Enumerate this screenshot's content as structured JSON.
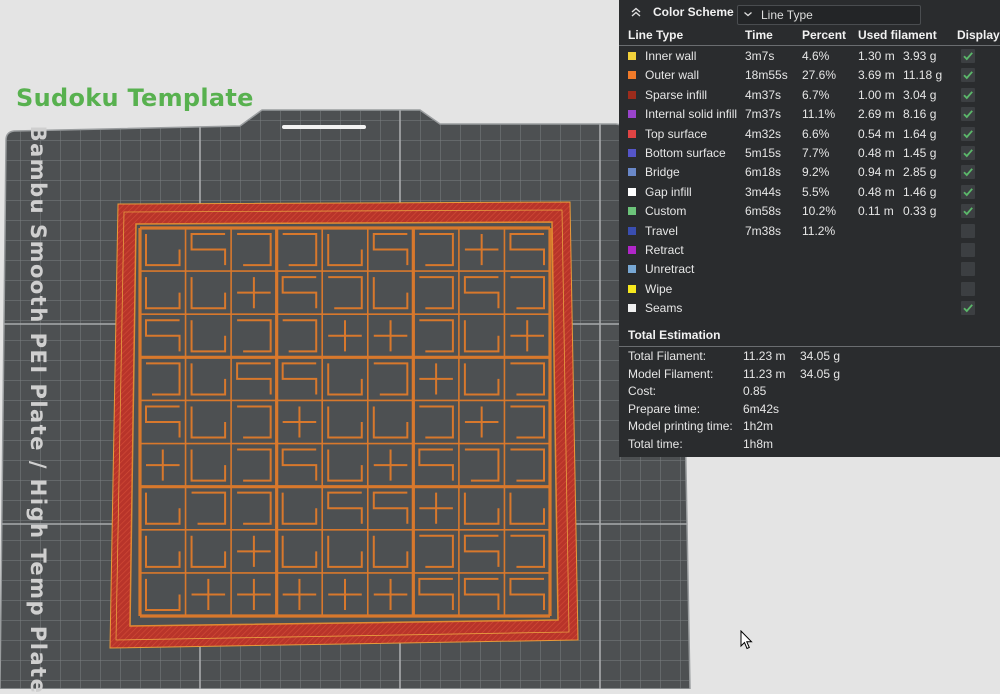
{
  "plate": {
    "title": "Sudoku Template",
    "label": "Bambu Smooth PEI Plate / High Temp Plate"
  },
  "panel": {
    "title": "Color Scheme",
    "scheme_value": "Line Type",
    "headers": {
      "line_type": "Line Type",
      "time": "Time",
      "percent": "Percent",
      "used_filament": "Used filament",
      "display": "Display"
    },
    "rows": [
      {
        "name": "Inner wall",
        "color": "#f2d13b",
        "time": "3m7s",
        "percent": "4.6%",
        "length": "1.30 m",
        "weight": "3.93 g",
        "display": true
      },
      {
        "name": "Outer wall",
        "color": "#f07a2a",
        "time": "18m55s",
        "percent": "27.6%",
        "length": "3.69 m",
        "weight": "11.18 g",
        "display": true
      },
      {
        "name": "Sparse infill",
        "color": "#9c2c1c",
        "time": "4m37s",
        "percent": "6.7%",
        "length": "1.00 m",
        "weight": "3.04 g",
        "display": true
      },
      {
        "name": "Internal solid infill",
        "color": "#9a44cc",
        "time": "7m37s",
        "percent": "11.1%",
        "length": "2.69 m",
        "weight": "8.16 g",
        "display": true
      },
      {
        "name": "Top surface",
        "color": "#e04444",
        "time": "4m32s",
        "percent": "6.6%",
        "length": "0.54 m",
        "weight": "1.64 g",
        "display": true
      },
      {
        "name": "Bottom surface",
        "color": "#5555c8",
        "time": "5m15s",
        "percent": "7.7%",
        "length": "0.48 m",
        "weight": "1.45 g",
        "display": true
      },
      {
        "name": "Bridge",
        "color": "#6a88c8",
        "time": "6m18s",
        "percent": "9.2%",
        "length": "0.94 m",
        "weight": "2.85 g",
        "display": true
      },
      {
        "name": "Gap infill",
        "color": "#ffffff",
        "time": "3m44s",
        "percent": "5.5%",
        "length": "0.48 m",
        "weight": "1.46 g",
        "display": true
      },
      {
        "name": "Custom",
        "color": "#6cc47a",
        "time": "6m58s",
        "percent": "10.2%",
        "length": "0.11 m",
        "weight": "0.33 g",
        "display": true
      },
      {
        "name": "Travel",
        "color": "#3a4eb0",
        "time": "7m38s",
        "percent": "11.2%",
        "length": "",
        "weight": "",
        "display": false
      },
      {
        "name": "Retract",
        "color": "#b026c8",
        "time": "",
        "percent": "",
        "length": "",
        "weight": "",
        "display": false
      },
      {
        "name": "Unretract",
        "color": "#78a8d4",
        "time": "",
        "percent": "",
        "length": "",
        "weight": "",
        "display": false
      },
      {
        "name": "Wipe",
        "color": "#f6e81e",
        "time": "",
        "percent": "",
        "length": "",
        "weight": "",
        "display": false
      },
      {
        "name": "Seams",
        "color": "#f0f0f0",
        "time": "",
        "percent": "",
        "length": "",
        "weight": "",
        "display": true
      }
    ],
    "total": {
      "title": "Total Estimation",
      "rows": [
        {
          "label": "Total Filament:",
          "value": "11.23 m",
          "value2": "34.05 g"
        },
        {
          "label": "Model Filament:",
          "value": "11.23 m",
          "value2": "34.05 g"
        },
        {
          "label": "Cost:",
          "value": "0.85",
          "value2": ""
        },
        {
          "label": "Prepare time:",
          "value": "6m42s",
          "value2": ""
        },
        {
          "label": "Model printing time:",
          "value": "1h2m",
          "value2": ""
        },
        {
          "label": "Total time:",
          "value": "1h8m",
          "value2": ""
        }
      ]
    }
  },
  "colors": {
    "panel_bg": "#2a2c2e",
    "plate": "#4d5052",
    "grid_line": "#8c8f91",
    "model_border": "#b8342a",
    "model_lines": "#d8782c",
    "check": "#5bb86a",
    "title_green": "#58b14f"
  }
}
